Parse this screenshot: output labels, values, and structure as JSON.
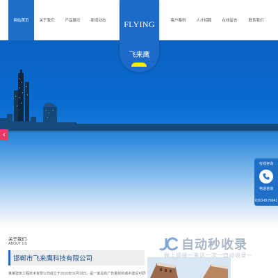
{
  "nav": {
    "items": [
      {
        "label": "网站首页",
        "active": true
      },
      {
        "label": "关于我们"
      },
      {
        "label": "产品展示"
      },
      {
        "label": "新闻动态"
      },
      {
        "label": "客户案例"
      },
      {
        "label": "人才招聘"
      },
      {
        "label": "在线留言"
      },
      {
        "label": "联系我们"
      }
    ]
  },
  "logo": {
    "top_text": "FLYING",
    "bottom_text": "飞来鹰"
  },
  "banner": {
    "arrow_icon": "chevron-left-icon"
  },
  "service": {
    "title": "在线咨询",
    "phone_label": "电话咨询",
    "phone": "0310-8179241"
  },
  "about": {
    "title": "关于我们",
    "subtitle": "ABOUT US",
    "company_name": "邯郸市飞来鹰科技有限公司",
    "description": "某某建筑工程技术有限公司成立于2010年01月19日。是一家具有广告策划和城乡建设可研"
  },
  "watermark": {
    "brand": "自动秒收录",
    "slogan": "做上链接一来访一次一自动收录一"
  },
  "colors": {
    "primary": "#1f6fc9",
    "accent": "#e8396b",
    "highlight": "#ffe900"
  }
}
